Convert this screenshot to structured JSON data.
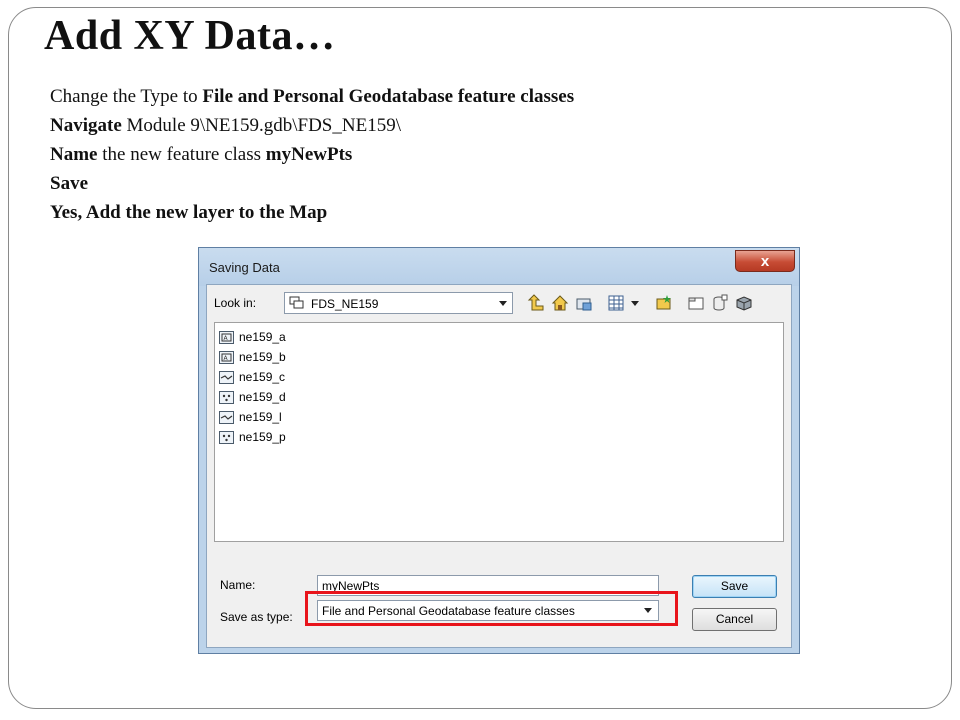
{
  "slide": {
    "title": "Add XY Data…",
    "bullets": [
      {
        "pre": "Change the Type to ",
        "bold": "File and Personal Geodatabase feature classes",
        "post": ""
      },
      {
        "pre": "",
        "bold": "Navigate",
        "post": " Module 9\\NE159.gdb\\FDS_NE159\\"
      },
      {
        "pre": "",
        "bold": "Name",
        "post": " the new feature class ",
        "bold2": "myNewPts"
      },
      {
        "pre": "",
        "bold": "Save",
        "post": ""
      },
      {
        "pre": "",
        "bold": "Yes, Add the new layer to the Map",
        "post": ""
      }
    ]
  },
  "dialog": {
    "title": "Saving Data",
    "close_symbol": "x",
    "look_in_label": "Look in:",
    "look_in_value": "FDS_NE159",
    "toolbar_icons": [
      "up-one-level-icon",
      "home-icon",
      "connect-folder-icon",
      "view-details-icon",
      "dropdown-arrow-icon",
      "new-feature-dataset-icon",
      "new-folder-icon",
      "new-table-icon",
      "new-toolbox-icon"
    ],
    "files": [
      {
        "name": "ne159_a",
        "icon": "annotation-class-icon"
      },
      {
        "name": "ne159_b",
        "icon": "annotation-class-icon"
      },
      {
        "name": "ne159_c",
        "icon": "line-class-icon"
      },
      {
        "name": "ne159_d",
        "icon": "point-class-icon"
      },
      {
        "name": "ne159_l",
        "icon": "line-class-icon"
      },
      {
        "name": "ne159_p",
        "icon": "point-class-icon"
      }
    ],
    "name_label": "Name:",
    "name_value": "myNewPts",
    "save_as_type_label": "Save as type:",
    "save_as_type_value": "File and Personal Geodatabase feature classes",
    "save_label": "Save",
    "cancel_label": "Cancel",
    "highlight_color": "#e8141b"
  }
}
